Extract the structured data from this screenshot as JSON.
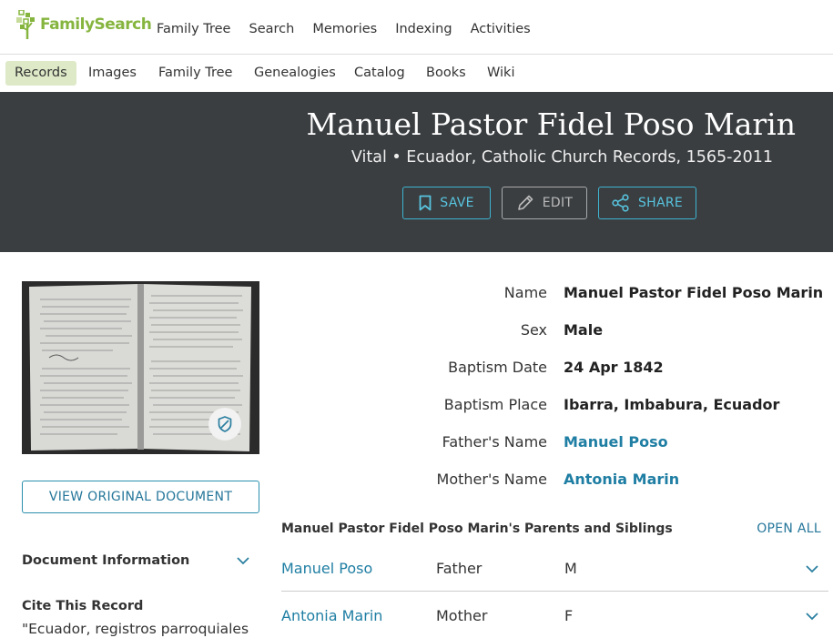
{
  "brand": {
    "name": "FamilySearch",
    "color": "#86b53f"
  },
  "top_nav": [
    "Family Tree",
    "Search",
    "Memories",
    "Indexing",
    "Activities"
  ],
  "sub_nav": {
    "active": "Records",
    "items": [
      "Records",
      "Images",
      "Family Tree",
      "Genealogies",
      "Catalog",
      "Books",
      "Wiki"
    ]
  },
  "record": {
    "title": "Manuel Pastor Fidel Poso Marin",
    "subtitle": "Vital • Ecuador, Catholic Church Records, 1565-2011"
  },
  "actions": {
    "save": "SAVE",
    "edit": "EDIT",
    "share": "SHARE"
  },
  "left": {
    "view_original": "VIEW ORIGINAL DOCUMENT",
    "document_information": "Document Information",
    "cite_title": "Cite This Record",
    "cite_text": "\"Ecuador, registros parroquiales"
  },
  "facts": [
    {
      "label": "Name",
      "value": "Manuel Pastor Fidel Poso Marin",
      "link": false
    },
    {
      "label": "Sex",
      "value": "Male",
      "link": false
    },
    {
      "label": "Baptism Date",
      "value": "24 Apr 1842",
      "link": false
    },
    {
      "label": "Baptism Place",
      "value": "Ibarra, Imbabura, Ecuador",
      "link": false
    },
    {
      "label": "Father's Name",
      "value": "Manuel Poso",
      "link": true
    },
    {
      "label": "Mother's Name",
      "value": "Antonia Marin",
      "link": true
    }
  ],
  "family": {
    "title": "Manuel Pastor Fidel Poso Marin's Parents and Siblings",
    "open_all": "OPEN ALL",
    "rows": [
      {
        "name": "Manuel Poso",
        "relation": "Father",
        "sex": "M"
      },
      {
        "name": "Antonia Marin",
        "relation": "Mother",
        "sex": "F"
      }
    ]
  },
  "colors": {
    "band": "#3a3e41",
    "accent": "#3fb4d1",
    "link": "#1f7ea3",
    "active_tab": "#dde9c7"
  }
}
